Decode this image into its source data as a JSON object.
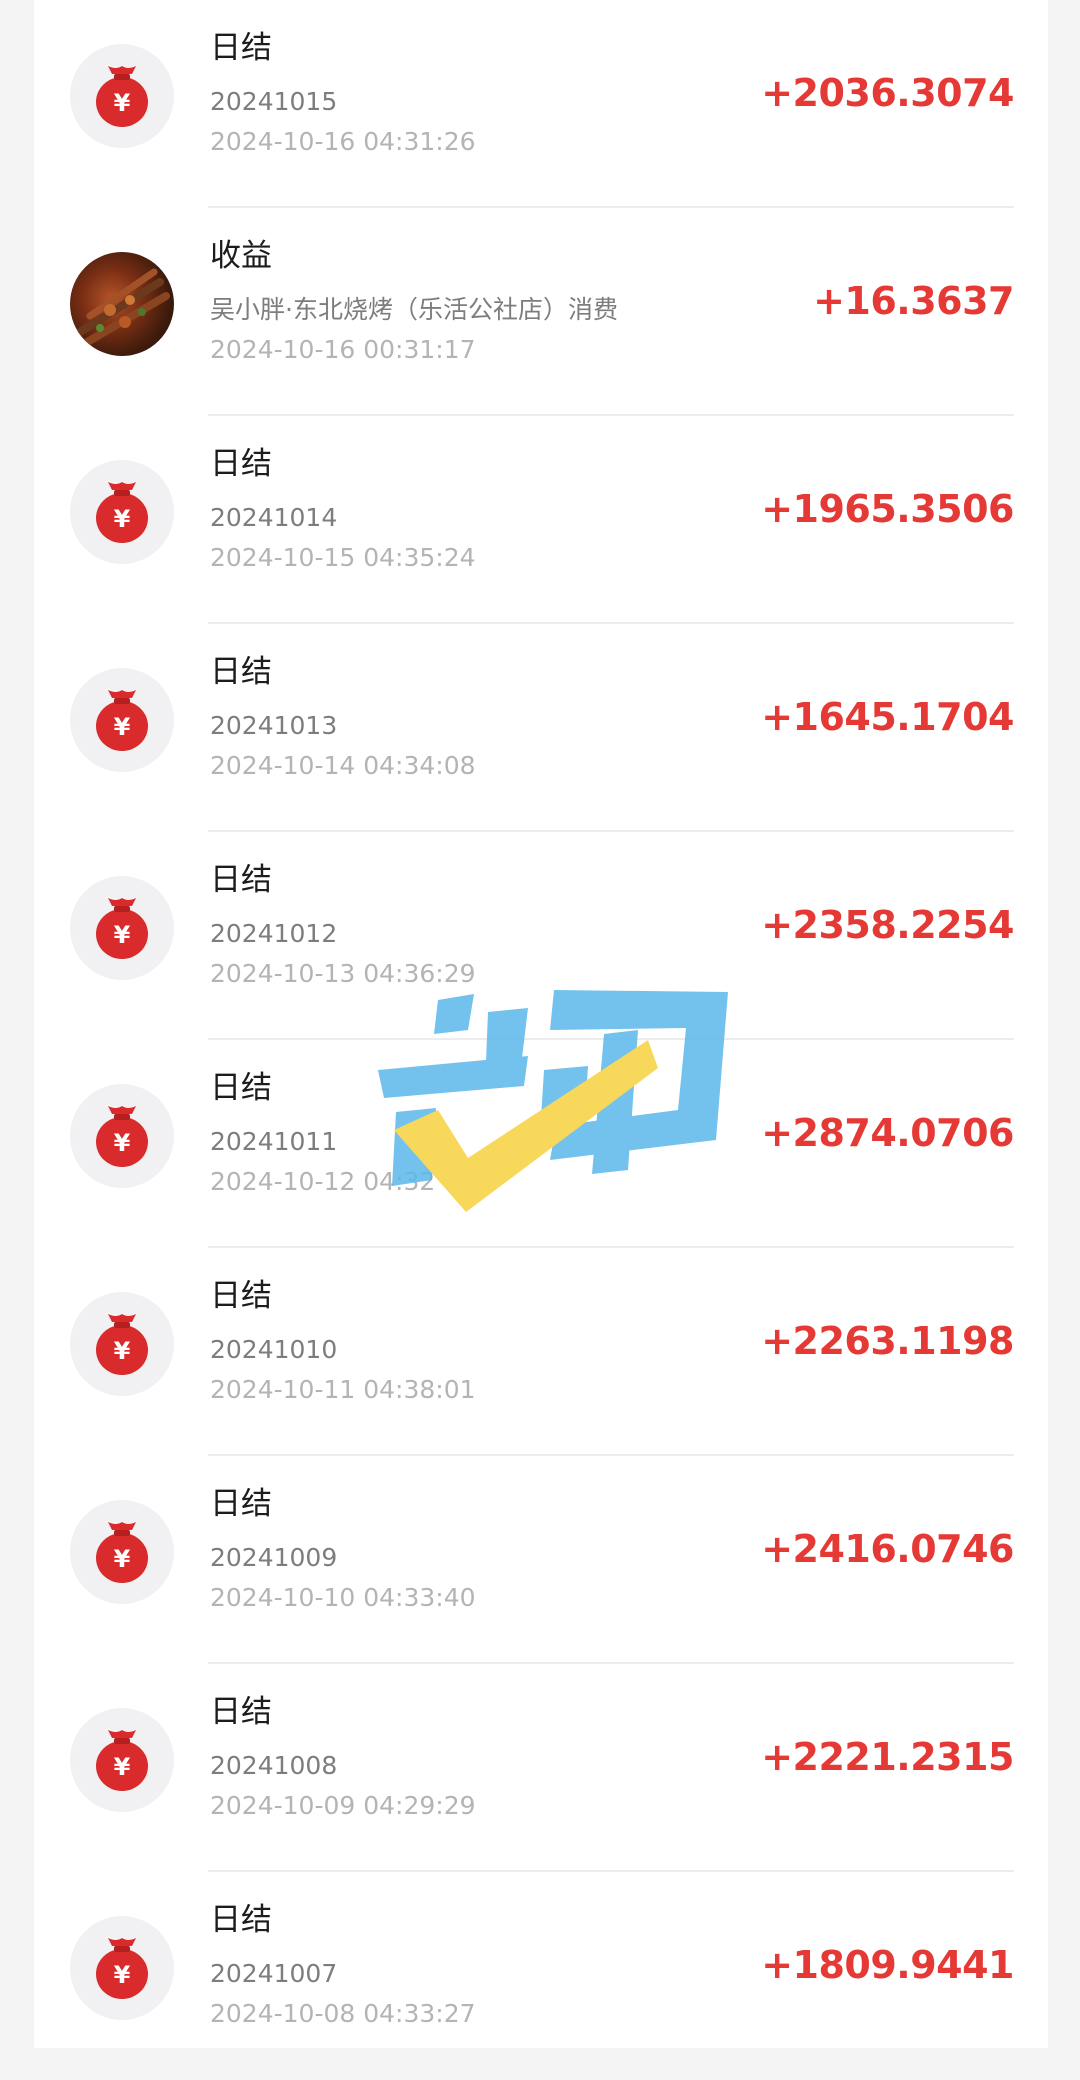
{
  "transactions": [
    {
      "title": "日结",
      "subtitle": "20241015",
      "time": "2024-10-16 04:31:26",
      "amount": "+2036.3074",
      "icon": "money-bag-icon"
    },
    {
      "title": "收益",
      "subtitle": "吴小胖·东北烧烤（乐活公社店）消费",
      "time": "2024-10-16 00:31:17",
      "amount": "+16.3637",
      "icon": "bbq-photo"
    },
    {
      "title": "日结",
      "subtitle": "20241014",
      "time": "2024-10-15 04:35:24",
      "amount": "+1965.3506",
      "icon": "money-bag-icon"
    },
    {
      "title": "日结",
      "subtitle": "20241013",
      "time": "2024-10-14 04:34:08",
      "amount": "+1645.1704",
      "icon": "money-bag-icon"
    },
    {
      "title": "日结",
      "subtitle": "20241012",
      "time": "2024-10-13 04:36:29",
      "amount": "+2358.2254",
      "icon": "money-bag-icon"
    },
    {
      "title": "日结",
      "subtitle": "20241011",
      "time": "2024-10-12 04:32",
      "amount": "+2874.0706",
      "icon": "money-bag-icon"
    },
    {
      "title": "日结",
      "subtitle": "20241010",
      "time": "2024-10-11 04:38:01",
      "amount": "+2263.1198",
      "icon": "money-bag-icon"
    },
    {
      "title": "日结",
      "subtitle": "20241009",
      "time": "2024-10-10 04:33:40",
      "amount": "+2416.0746",
      "icon": "money-bag-icon"
    },
    {
      "title": "日结",
      "subtitle": "20241008",
      "time": "2024-10-09 04:29:29",
      "amount": "+2221.2315",
      "icon": "money-bag-icon"
    },
    {
      "title": "日结",
      "subtitle": "20241007",
      "time": "2024-10-08 04:33:27",
      "amount": "+1809.9441",
      "icon": "money-bag-icon"
    }
  ],
  "colors": {
    "amount": "#e53935",
    "icon_bag": "#d92b2b",
    "watermark_blue": "#5bb8ec",
    "watermark_yellow": "#f7d23e"
  },
  "watermark": {
    "icon": "check-logo-watermark"
  }
}
